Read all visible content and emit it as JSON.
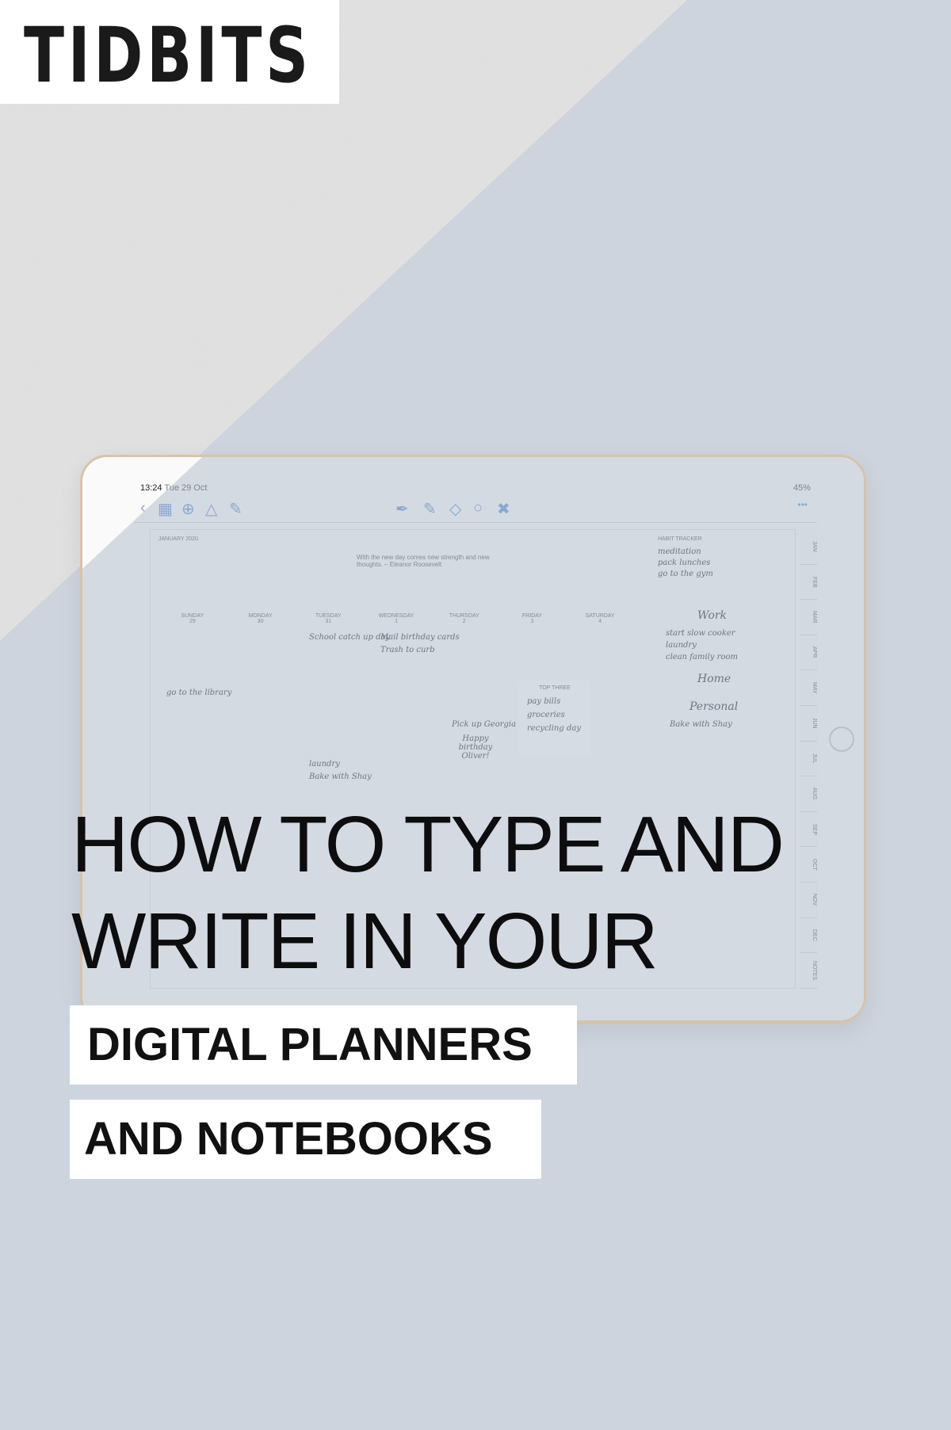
{
  "brand": {
    "logo": "TIDBITS"
  },
  "headline": {
    "line1": "HOW TO TYPE AND",
    "line2": "WRITE IN YOUR"
  },
  "subheadings": [
    "DIGITAL PLANNERS",
    "AND NOTEBOOKS"
  ],
  "colors": {
    "background": "#cdd4dd",
    "texture": "#e6e6e6",
    "text": "#0d0d0d",
    "label_bg": "#ffffff"
  },
  "tablet": {
    "time": "13:24",
    "date": "Tue 29 Oct",
    "battery": "45%",
    "month": "JANUARY 2020",
    "quote": "With the new day comes new strength and new thoughts. – Eleanor Roosevelt",
    "habit_title": "HABIT TRACKER",
    "habits": [
      "meditation",
      "pack lunches",
      "go to the gym"
    ],
    "days": [
      "SUNDAY",
      "MONDAY",
      "TUESDAY",
      "WEDNESDAY",
      "THURSDAY",
      "FRIDAY",
      "SATURDAY"
    ],
    "dates": [
      "29",
      "30",
      "31",
      "1",
      "2",
      "3",
      "4"
    ],
    "notes": [
      "School catch up day",
      "Mail birthday cards",
      "Trash to curb",
      "Pick up Georgia",
      "Happy birthday Oliver!",
      "laundry",
      "Bake with Shay",
      "go to the library"
    ],
    "top_three": {
      "title": "TOP THREE",
      "items": [
        "pay bills",
        "groceries",
        "recycling day"
      ]
    },
    "work": {
      "title": "Work",
      "items": [
        "start slow cooker",
        "laundry",
        "clean family room"
      ]
    },
    "home_title": "Home",
    "personal": {
      "title": "Personal",
      "items": [
        "Bake with Shay"
      ]
    },
    "tabs": [
      "JAN",
      "FEB",
      "MAR",
      "APR",
      "MAY",
      "JUN",
      "JUL",
      "AUG",
      "SEP",
      "OCT",
      "NOV",
      "DEC",
      "NOTES"
    ]
  }
}
